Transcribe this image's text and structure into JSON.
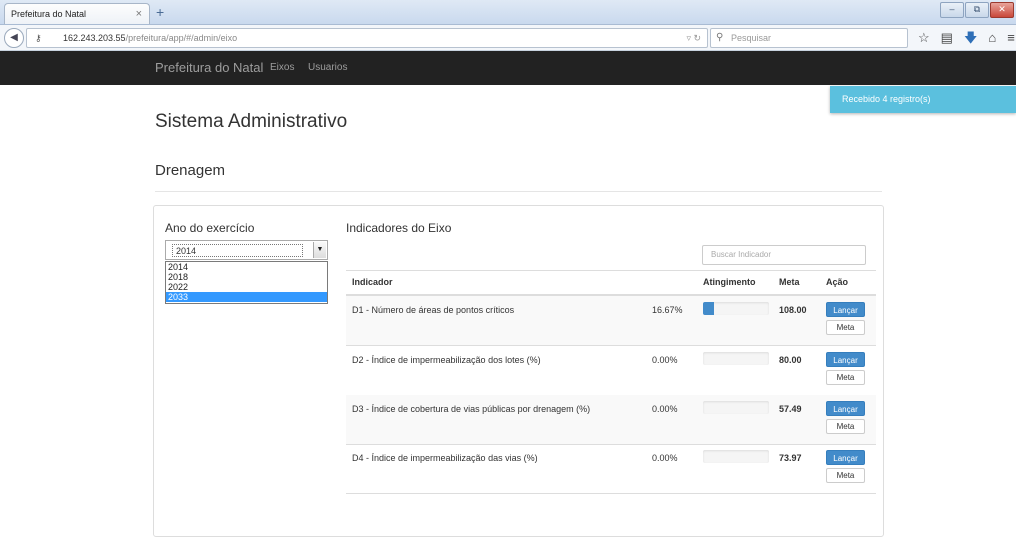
{
  "browser": {
    "tab_title": "Prefeitura do Natal",
    "tab_close": "×",
    "new_tab": "+",
    "url_host": "162.243.203.55",
    "url_path": "/prefeitura/app/#/admin/eixo",
    "search_placeholder": "Pesquisar"
  },
  "navbar": {
    "brand": "Prefeitura do Natal",
    "links": [
      "Eixos",
      "Usuarios"
    ]
  },
  "toast": "Recebido 4 registro(s)",
  "page": {
    "title": "Sistema Administrativo",
    "section": "Drenagem"
  },
  "year": {
    "label": "Ano do exercício",
    "selected": "2014",
    "options": [
      "2014",
      "2018",
      "2022",
      "2033"
    ],
    "highlighted_index": 3
  },
  "indicators": {
    "title": "Indicadores do Eixo",
    "search_placeholder": "Buscar Indicador",
    "headers": {
      "indicador": "Indicador",
      "atingimento": "Atingimento",
      "meta": "Meta",
      "acao": "Ação"
    },
    "rows": [
      {
        "name": "D1 - Número de áreas de pontos críticos",
        "pct": "16.67%",
        "progress": 16.67,
        "meta": "108.00",
        "btn_lancar": "Lançar",
        "btn_meta": "Meta"
      },
      {
        "name": "D2 - Índice de impermeabilização dos lotes (%)",
        "pct": "0.00%",
        "progress": 0,
        "meta": "80.00",
        "btn_lancar": "Lançar",
        "btn_meta": "Meta"
      },
      {
        "name": "D3 - Índice de cobertura de vias públicas por drenagem (%)",
        "pct": "0.00%",
        "progress": 0,
        "meta": "57.49",
        "btn_lancar": "Lançar",
        "btn_meta": "Meta"
      },
      {
        "name": "D4 - Índice de impermeabilização das vias (%)",
        "pct": "0.00%",
        "progress": 0,
        "meta": "73.97",
        "btn_lancar": "Lançar",
        "btn_meta": "Meta"
      }
    ]
  },
  "colors": {
    "primary": "#428bca",
    "navbar": "#222222",
    "toast": "#5bc0de",
    "highlight": "#3399ff"
  }
}
